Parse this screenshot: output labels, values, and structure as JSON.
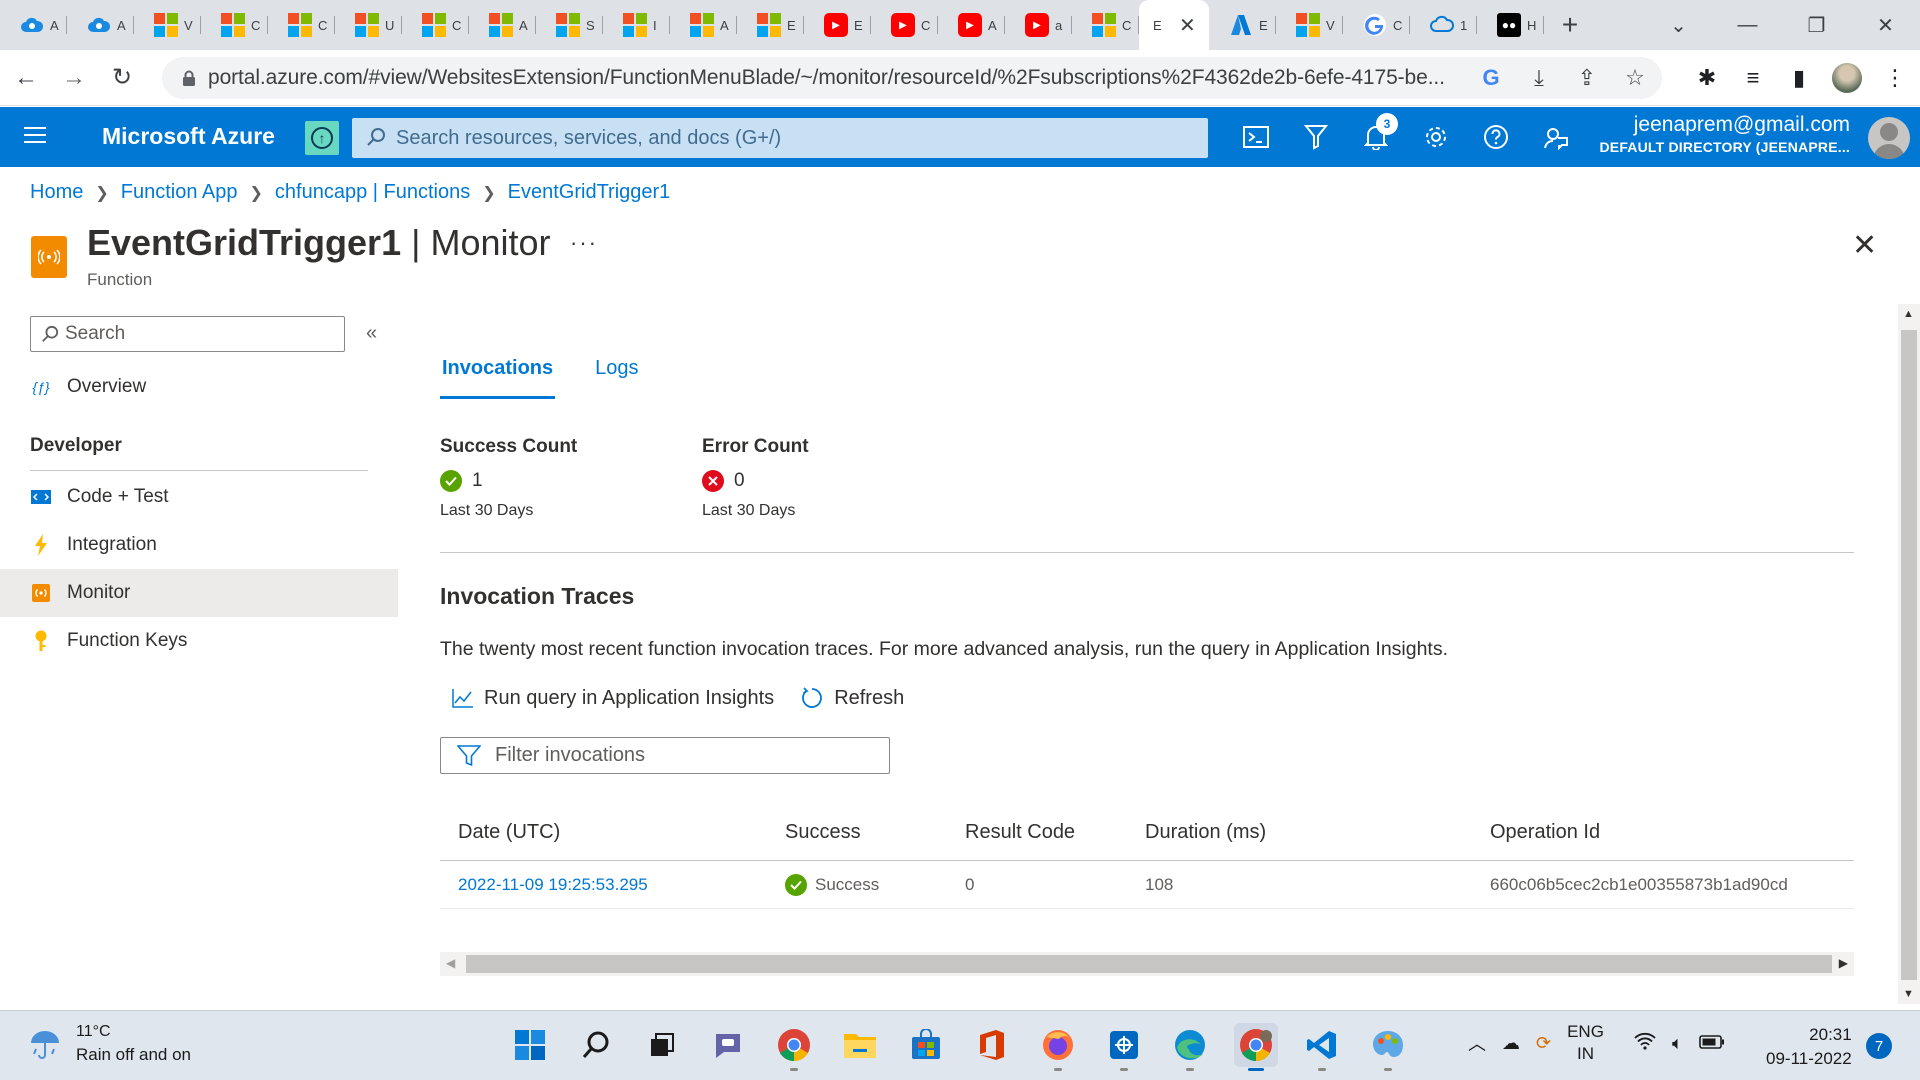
{
  "browser": {
    "tabs": [
      {
        "icon": "azure-cloud-icon",
        "label": "A"
      },
      {
        "icon": "azure-cloud-icon",
        "label": "A"
      },
      {
        "icon": "microsoft-icon",
        "label": "V"
      },
      {
        "icon": "microsoft-icon",
        "label": "C"
      },
      {
        "icon": "microsoft-icon",
        "label": "C"
      },
      {
        "icon": "microsoft-icon",
        "label": "U"
      },
      {
        "icon": "microsoft-icon",
        "label": "C"
      },
      {
        "icon": "microsoft-icon",
        "label": "A"
      },
      {
        "icon": "microsoft-icon",
        "label": "S"
      },
      {
        "icon": "microsoft-icon",
        "label": "I"
      },
      {
        "icon": "microsoft-icon",
        "label": "A"
      },
      {
        "icon": "microsoft-icon",
        "label": "E"
      },
      {
        "icon": "youtube-icon",
        "label": "E"
      },
      {
        "icon": "youtube-icon",
        "label": "C"
      },
      {
        "icon": "youtube-icon",
        "label": "A"
      },
      {
        "icon": "youtube-icon",
        "label": "a"
      },
      {
        "icon": "microsoft-icon",
        "label": "C"
      },
      {
        "icon": "none",
        "label": "E",
        "active": true
      },
      {
        "icon": "azure-a-icon",
        "label": "E"
      },
      {
        "icon": "microsoft-icon",
        "label": "V"
      },
      {
        "icon": "google-icon",
        "label": "C"
      },
      {
        "icon": "cloud-sync-icon",
        "label": "1"
      },
      {
        "icon": "medium-icon",
        "label": "H"
      }
    ],
    "url": "portal.azure.com/#view/WebsitesExtension/FunctionMenuBlade/~/monitor/resourceId/%2Fsubscriptions%2F4362de2b-6efe-4175-be..."
  },
  "azure": {
    "brand": "Microsoft Azure",
    "search_placeholder": "Search resources, services, and docs (G+/)",
    "notification_count": "3",
    "account_email": "jeenaprem@gmail.com",
    "account_directory": "DEFAULT DIRECTORY (JEENAPRE..."
  },
  "breadcrumb": [
    "Home",
    "Function App",
    "chfuncapp | Functions",
    "EventGridTrigger1"
  ],
  "resource": {
    "name": "EventGridTrigger1",
    "separator": " | ",
    "blade": "Monitor",
    "type": "Function",
    "more": "···"
  },
  "menu": {
    "search_placeholder": "Search",
    "collapse": "«",
    "overview": "Overview",
    "section": "Developer",
    "items": [
      {
        "label": "Code + Test",
        "icon": "code-icon"
      },
      {
        "label": "Integration",
        "icon": "lightning-icon"
      },
      {
        "label": "Monitor",
        "icon": "monitor-icon",
        "selected": true
      },
      {
        "label": "Function Keys",
        "icon": "key-icon"
      }
    ]
  },
  "content": {
    "tabs": [
      {
        "label": "Invocations",
        "active": true
      },
      {
        "label": "Logs"
      }
    ],
    "success": {
      "label": "Success Count",
      "value": "1",
      "period": "Last 30 Days"
    },
    "error": {
      "label": "Error Count",
      "value": "0",
      "period": "Last 30 Days"
    },
    "traces_title": "Invocation Traces",
    "traces_desc": "The twenty most recent function invocation traces. For more advanced analysis, run the query in Application Insights.",
    "run_query": "Run query in Application Insights",
    "refresh": "Refresh",
    "filter_placeholder": "Filter invocations",
    "columns": [
      "Date (UTC)",
      "Success",
      "Result Code",
      "Duration (ms)",
      "Operation Id"
    ],
    "rows": [
      {
        "date": "2022-11-09 19:25:53.295",
        "success": "Success",
        "result_code": "0",
        "duration": "108",
        "operation_id": "660c06b5cec2cb1e00355873b1ad90cd"
      }
    ]
  },
  "taskbar": {
    "temperature": "11°C",
    "weather": "Rain off and on",
    "lang_top": "ENG",
    "lang_bottom": "IN",
    "time": "20:31",
    "date": "09-11-2022",
    "notification_count": "7"
  },
  "colors": {
    "azure_blue": "#0078d4",
    "success_green": "#57a300",
    "error_red": "#e00b1c",
    "function_orange": "#f28b00"
  }
}
